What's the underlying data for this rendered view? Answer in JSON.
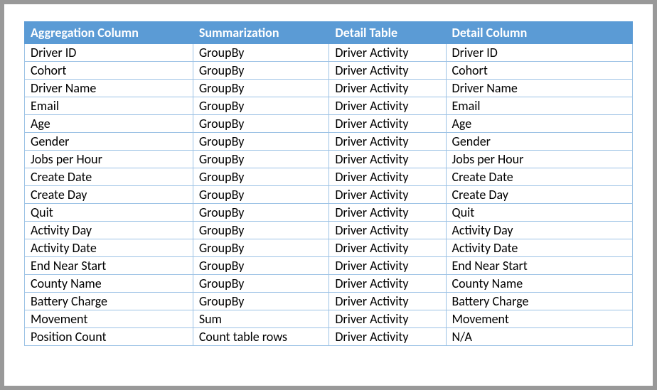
{
  "headers": {
    "aggregation_column": "Aggregation Column",
    "summarization": "Summarization",
    "detail_table": "Detail Table",
    "detail_column": "Detail Column"
  },
  "rows": [
    {
      "aggregation_column": "Driver ID",
      "summarization": "GroupBy",
      "detail_table": "Driver Activity",
      "detail_column": "Driver ID"
    },
    {
      "aggregation_column": "Cohort",
      "summarization": "GroupBy",
      "detail_table": "Driver Activity",
      "detail_column": "Cohort"
    },
    {
      "aggregation_column": "Driver Name",
      "summarization": "GroupBy",
      "detail_table": "Driver Activity",
      "detail_column": "Driver Name"
    },
    {
      "aggregation_column": "Email",
      "summarization": "GroupBy",
      "detail_table": "Driver Activity",
      "detail_column": "Email"
    },
    {
      "aggregation_column": "Age",
      "summarization": "GroupBy",
      "detail_table": "Driver Activity",
      "detail_column": "Age"
    },
    {
      "aggregation_column": "Gender",
      "summarization": "GroupBy",
      "detail_table": "Driver Activity",
      "detail_column": "Gender"
    },
    {
      "aggregation_column": "Jobs per Hour",
      "summarization": "GroupBy",
      "detail_table": "Driver Activity",
      "detail_column": "Jobs per Hour"
    },
    {
      "aggregation_column": "Create Date",
      "summarization": "GroupBy",
      "detail_table": "Driver Activity",
      "detail_column": "Create Date"
    },
    {
      "aggregation_column": "Create Day",
      "summarization": "GroupBy",
      "detail_table": "Driver Activity",
      "detail_column": "Create Day"
    },
    {
      "aggregation_column": "Quit",
      "summarization": "GroupBy",
      "detail_table": "Driver Activity",
      "detail_column": "Quit"
    },
    {
      "aggregation_column": "Activity Day",
      "summarization": "GroupBy",
      "detail_table": "Driver Activity",
      "detail_column": "Activity Day"
    },
    {
      "aggregation_column": "Activity Date",
      "summarization": "GroupBy",
      "detail_table": "Driver Activity",
      "detail_column": "Activity Date"
    },
    {
      "aggregation_column": "End Near Start",
      "summarization": "GroupBy",
      "detail_table": "Driver Activity",
      "detail_column": "End Near Start"
    },
    {
      "aggregation_column": "County Name",
      "summarization": "GroupBy",
      "detail_table": "Driver Activity",
      "detail_column": "County Name"
    },
    {
      "aggregation_column": "Battery Charge",
      "summarization": "GroupBy",
      "detail_table": "Driver Activity",
      "detail_column": "Battery Charge"
    },
    {
      "aggregation_column": "Movement",
      "summarization": "Sum",
      "detail_table": "Driver Activity",
      "detail_column": "Movement"
    },
    {
      "aggregation_column": "Position Count",
      "summarization": "Count table rows",
      "detail_table": "Driver Activity",
      "detail_column": "N/A"
    }
  ]
}
